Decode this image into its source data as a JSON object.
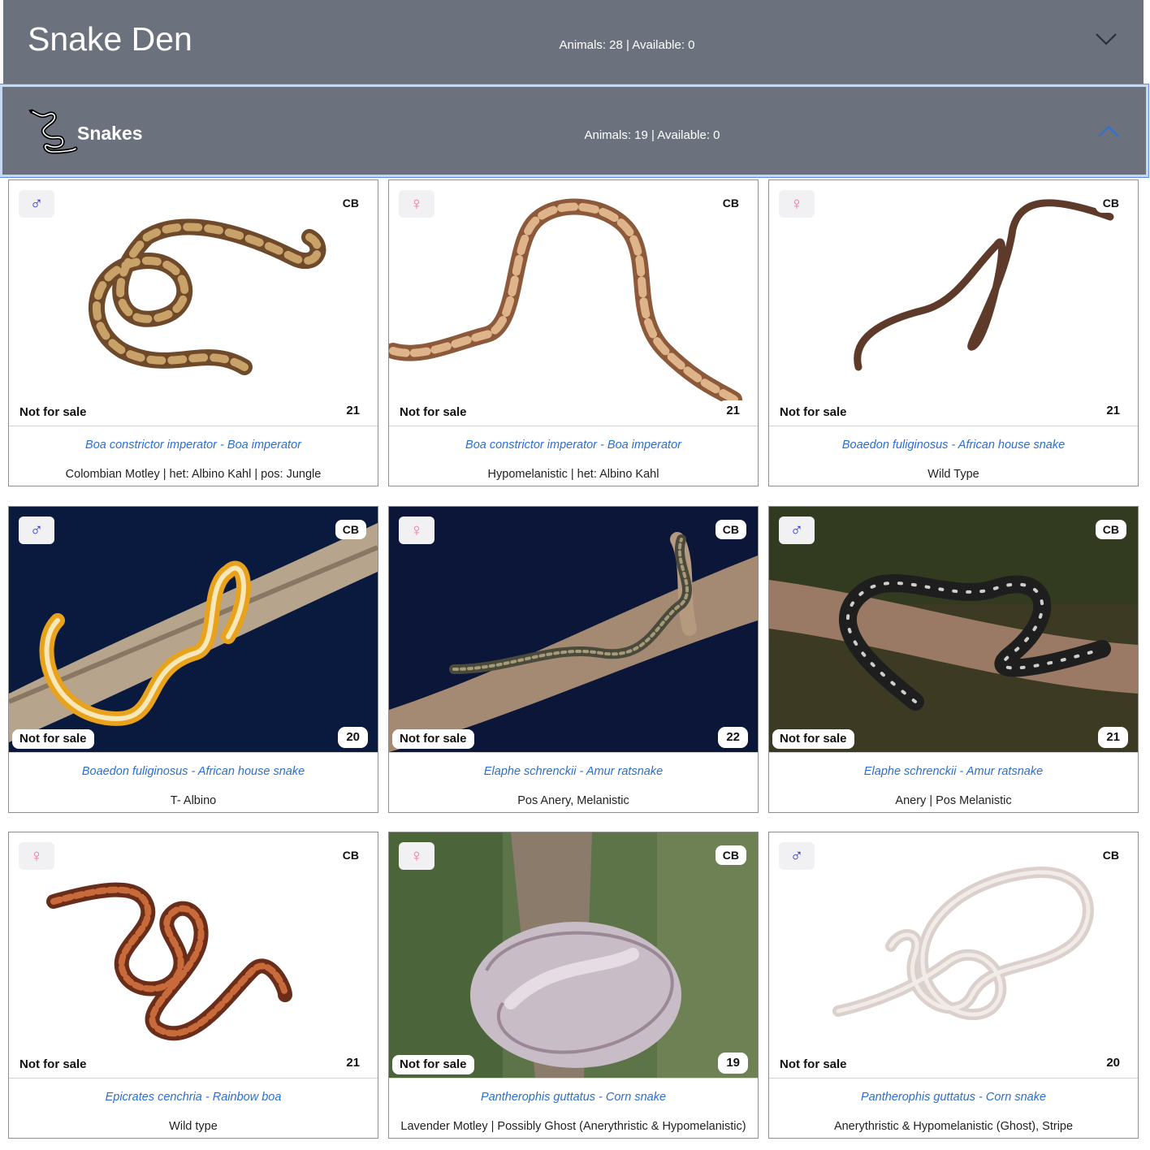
{
  "header": {
    "title": "Snake Den",
    "stats": "Animals: 28 | Available: 0"
  },
  "category": {
    "title": "Snakes",
    "stats": "Animals: 19 | Available: 0",
    "icon": "snake-icon"
  },
  "colors": {
    "panel_bg": "#6b727d",
    "species_link": "#2a6fd0",
    "male": "#2d33c8",
    "female": "#f071a8"
  },
  "cards": [
    {
      "sex_symbol": "♂",
      "sex": "male",
      "origin": "CB",
      "sale": "Not for sale",
      "number": "21",
      "species": "Boa constrictor imperator - Boa imperator",
      "morph": "Colombian Motley | het: Albino Kahl | pos: Jungle"
    },
    {
      "sex_symbol": "♀",
      "sex": "female",
      "origin": "CB",
      "sale": "Not for sale",
      "number": "21",
      "species": "Boa constrictor imperator - Boa imperator",
      "morph": "Hypomelanistic | het: Albino Kahl"
    },
    {
      "sex_symbol": "♀",
      "sex": "female",
      "origin": "CB",
      "sale": "Not for sale",
      "number": "21",
      "species": "Boaedon fuliginosus - African house snake",
      "morph": "Wild Type"
    },
    {
      "sex_symbol": "♂",
      "sex": "male",
      "origin": "CB",
      "sale": "Not for sale",
      "number": "20",
      "species": "Boaedon fuliginosus - African house snake",
      "morph": "T- Albino"
    },
    {
      "sex_symbol": "♀",
      "sex": "female",
      "origin": "CB",
      "sale": "Not for sale",
      "number": "22",
      "species": "Elaphe schrenckii - Amur ratsnake",
      "morph": "Pos Anery, Melanistic"
    },
    {
      "sex_symbol": "♂",
      "sex": "male",
      "origin": "CB",
      "sale": "Not for sale",
      "number": "21",
      "species": "Elaphe schrenckii - Amur ratsnake",
      "morph": "Anery | Pos Melanistic"
    },
    {
      "sex_symbol": "♀",
      "sex": "female",
      "origin": "CB",
      "sale": "Not for sale",
      "number": "21",
      "species": "Epicrates cenchria - Rainbow boa",
      "morph": "Wild type"
    },
    {
      "sex_symbol": "♀",
      "sex": "female",
      "origin": "CB",
      "sale": "Not for sale",
      "number": "19",
      "species": "Pantherophis guttatus - Corn snake",
      "morph": "Lavender Motley | Possibly Ghost (Anerythristic & Hypomelanistic)"
    },
    {
      "sex_symbol": "♂",
      "sex": "male",
      "origin": "CB",
      "sale": "Not for sale",
      "number": "20",
      "species": "Pantherophis guttatus - Corn snake",
      "morph": "Anerythristic & Hypomelanistic (Ghost), Stripe"
    }
  ]
}
